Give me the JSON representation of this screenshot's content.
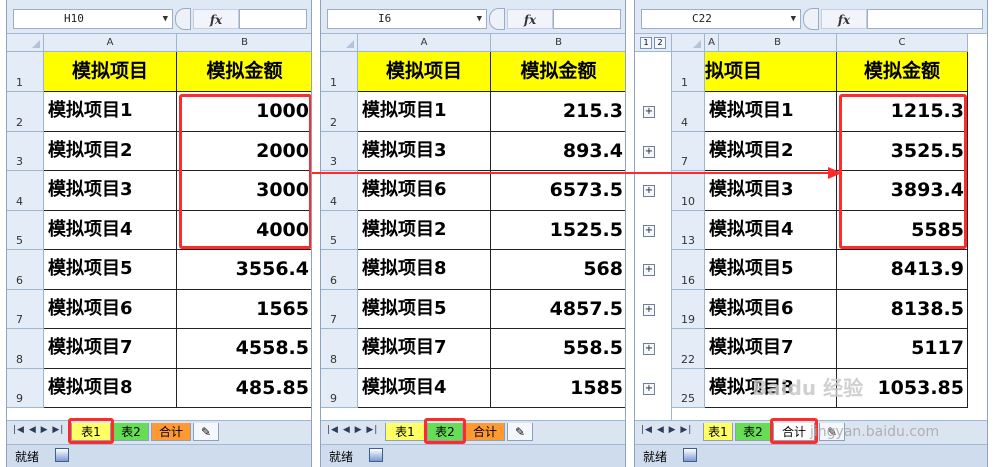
{
  "panels": [
    {
      "name_box": "H10",
      "columns": [
        "A",
        "B"
      ],
      "row_labels": [
        "1",
        "2",
        "3",
        "4",
        "5",
        "6",
        "7",
        "8",
        "9"
      ],
      "headers": [
        "模拟项目",
        "模拟金额"
      ],
      "rows": [
        [
          "模拟项目1",
          "1000"
        ],
        [
          "模拟项目2",
          "2000"
        ],
        [
          "模拟项目3",
          "3000"
        ],
        [
          "模拟项目4",
          "4000"
        ],
        [
          "模拟项目5",
          "3556.4"
        ],
        [
          "模拟项目6",
          "1565"
        ],
        [
          "模拟项目7",
          "4558.5"
        ],
        [
          "模拟项目8",
          "485.85"
        ]
      ],
      "tabs": [
        "表1",
        "表2",
        "合计"
      ],
      "active_tab": "表1",
      "status": "就绪"
    },
    {
      "name_box": "I6",
      "columns": [
        "A",
        "B"
      ],
      "row_labels": [
        "1",
        "2",
        "3",
        "4",
        "5",
        "6",
        "7",
        "8",
        "9"
      ],
      "headers": [
        "模拟项目",
        "模拟金额"
      ],
      "rows": [
        [
          "模拟项目1",
          "215.3"
        ],
        [
          "模拟项目3",
          "893.4"
        ],
        [
          "模拟项目6",
          "6573.5"
        ],
        [
          "模拟项目2",
          "1525.5"
        ],
        [
          "模拟项目8",
          "568"
        ],
        [
          "模拟项目5",
          "4857.5"
        ],
        [
          "模拟项目7",
          "558.5"
        ],
        [
          "模拟项目4",
          "1585"
        ]
      ],
      "tabs": [
        "表1",
        "表2",
        "合计"
      ],
      "active_tab": "表2",
      "status": "就绪"
    },
    {
      "name_box": "C22",
      "columns": [
        "A",
        "B",
        "C"
      ],
      "outline_levels": [
        "1",
        "2"
      ],
      "row_labels": [
        "1",
        "4",
        "7",
        "10",
        "13",
        "16",
        "19",
        "22",
        "25"
      ],
      "headers": [
        "拟项目",
        "模拟金额"
      ],
      "rows": [
        [
          "模拟项目1",
          "1215.3"
        ],
        [
          "模拟项目2",
          "3525.5"
        ],
        [
          "模拟项目3",
          "3893.4"
        ],
        [
          "模拟项目4",
          "5585"
        ],
        [
          "模拟项目5",
          "8413.9"
        ],
        [
          "模拟项目6",
          "8138.5"
        ],
        [
          "模拟项目7",
          "5117"
        ],
        [
          "模拟项目8",
          "1053.85"
        ]
      ],
      "tabs": [
        "表1",
        "表2",
        "合计"
      ],
      "active_tab": "合计",
      "status": "就绪"
    }
  ],
  "watermark": "Baidu 经验",
  "watermark_url": "jingyan.baidu.com",
  "colors": {
    "header_fill": "#ffff00",
    "highlight": "#ff2a2a",
    "tab_sheet1": "#ffff66",
    "tab_sheet2": "#66dd55",
    "tab_total": "#ff9933"
  }
}
